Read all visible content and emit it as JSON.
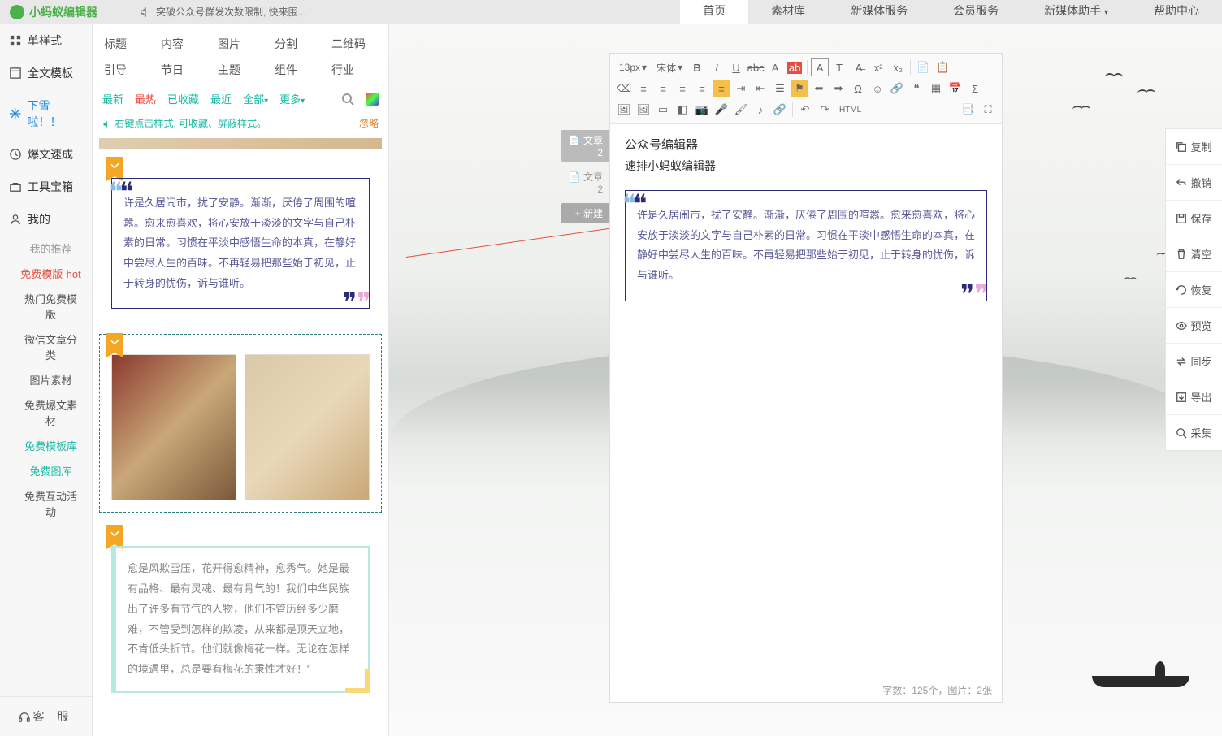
{
  "logo": "小蚂蚁编辑器",
  "announce": "突破公众号群发次数限制, 快来围...",
  "topnav": [
    "首页",
    "素材库",
    "新媒体服务",
    "会员服务",
    "新媒体助手",
    "帮助中心"
  ],
  "sidebar": {
    "items": [
      {
        "label": "单样式"
      },
      {
        "label": "全文模板"
      },
      {
        "label": "下雪啦！！"
      },
      {
        "label": "爆文速成"
      },
      {
        "label": "工具宝箱"
      },
      {
        "label": "我的"
      }
    ],
    "subs": [
      {
        "label": "我的推荐",
        "cls": "gray"
      },
      {
        "label": "免费模版-hot",
        "cls": "red"
      },
      {
        "label": "热门免费模版",
        "cls": ""
      },
      {
        "label": "微信文章分类",
        "cls": ""
      },
      {
        "label": "图片素材",
        "cls": ""
      },
      {
        "label": "免费爆文素材",
        "cls": ""
      },
      {
        "label": "免费模板库",
        "cls": "teal"
      },
      {
        "label": "免费图库",
        "cls": "teal"
      },
      {
        "label": "免费互动活动",
        "cls": ""
      }
    ],
    "footer": "客 服"
  },
  "tpl": {
    "tabs_row1": [
      "标题",
      "内容",
      "图片",
      "分割",
      "二维码"
    ],
    "tabs_row2": [
      "引导",
      "节日",
      "主题",
      "组件",
      "行业"
    ],
    "filters": {
      "new": "最新",
      "hot": "最热",
      "fav": "已收藏",
      "near": "最近",
      "all": "全部",
      "more": "更多"
    },
    "hint": "右键点击样式, 可收藏、屏蔽样式。",
    "ignore": "忽略",
    "card1_text": "许是久居闹市，扰了安静。渐渐，厌倦了周围的喧嚣。愈来愈喜欢，将心安放于淡淡的文字与自己朴素的日常。习惯在平淡中感悟生命的本真，在静好中尝尽人生的百味。不再轻易把那些始于初见，止于转身的忧伤，诉与谁听。",
    "card3_text": "愈是风欺雪压，花开得愈精神，愈秀气。她是最有品格、最有灵魂、最有骨气的！我们中华民族出了许多有节气的人物，他们不管历经多少磨难，不管受到怎样的欺凌，从来都是顶天立地，不肯低头折节。他们就像梅花一样。无论在怎样的境遇里，总是要有梅花的秉性才好！\""
  },
  "docs": {
    "tab1": "文章2",
    "tab2": "文章2",
    "new": "+ 新建"
  },
  "editor": {
    "font_size": "13px",
    "font_family": "宋体",
    "title": "公众号编辑器",
    "sub": "速排小蚂蚁编辑器",
    "block_text": "许是久居闹市，扰了安静。渐渐，厌倦了周围的喧嚣。愈来愈喜欢，将心安放于淡淡的文字与自己朴素的日常。习惯在平淡中感悟生命的本真，在静好中尝尽人生的百味。不再轻易把那些始于初见，止于转身的忧伤，诉与谁听。",
    "footer": "字数：125个，图片：2张",
    "html_label": "HTML"
  },
  "actions": [
    "复制",
    "撤销",
    "保存",
    "清空",
    "恢复",
    "预览",
    "同步",
    "导出",
    "采集"
  ]
}
